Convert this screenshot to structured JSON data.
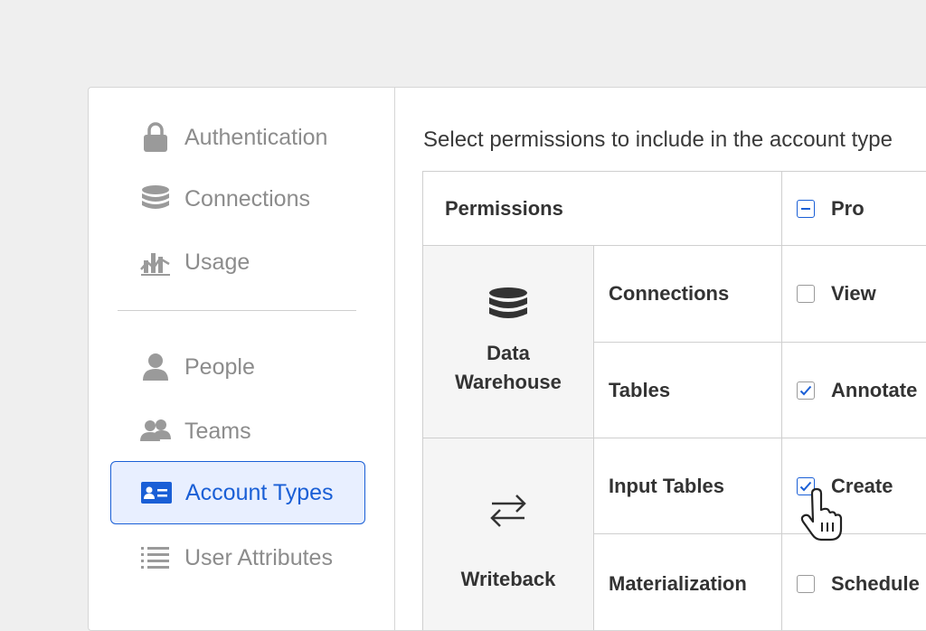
{
  "sidebar": {
    "items": [
      {
        "label": "Authentication",
        "icon": "lock-icon"
      },
      {
        "label": "Connections",
        "icon": "database-icon"
      },
      {
        "label": "Usage",
        "icon": "chart-icon"
      },
      {
        "label": "People",
        "icon": "person-icon"
      },
      {
        "label": "Teams",
        "icon": "group-icon"
      },
      {
        "label": "Account Types",
        "icon": "id-card-icon",
        "active": true
      },
      {
        "label": "User Attributes",
        "icon": "list-icon"
      }
    ]
  },
  "main": {
    "subtitle": "Select permissions to include in the account type",
    "table": {
      "header_label": "Permissions",
      "plan_label": "Pro",
      "categories": [
        {
          "label_line1": "Data",
          "label_line2": "Warehouse",
          "icon": "database-icon"
        },
        {
          "label": "Writeback",
          "icon": "arrows-swap-icon"
        }
      ],
      "rows": [
        {
          "name": "Connections",
          "permission": "View",
          "checked": false
        },
        {
          "name": "Tables",
          "permission": "Annotate",
          "checked": true
        },
        {
          "name": "Input Tables",
          "permission": "Create",
          "checked": true
        },
        {
          "name": "Materialization",
          "permission": "Schedule",
          "checked": false
        }
      ]
    }
  },
  "colors": {
    "accent": "#1a5fd6",
    "muted": "#8c8c8c",
    "text": "#333333"
  }
}
